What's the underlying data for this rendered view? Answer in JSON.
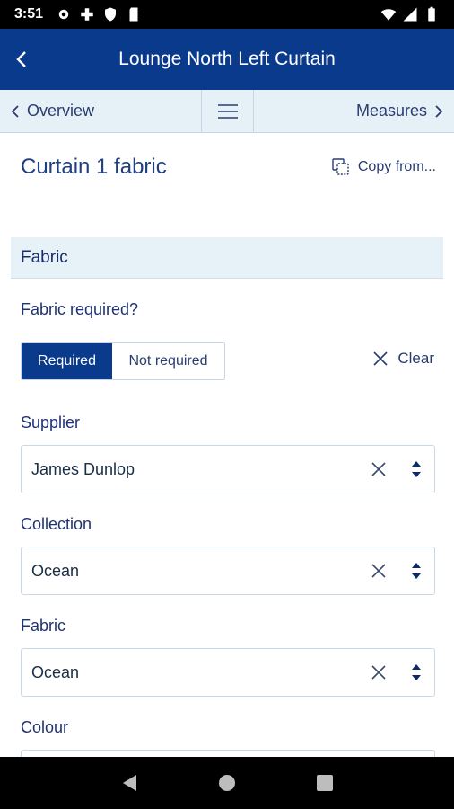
{
  "status_bar": {
    "time": "3:51"
  },
  "app_bar": {
    "title": "Lounge North Left Curtain"
  },
  "sub_nav": {
    "overview_label": "Overview",
    "measures_label": "Measures"
  },
  "page": {
    "heading": "Curtain 1 fabric",
    "copy_from_label": "Copy from..."
  },
  "section": {
    "title": "Fabric"
  },
  "fabric_required": {
    "label": "Fabric required?",
    "options": [
      "Required",
      "Not required"
    ],
    "selected": "Required",
    "clear_label": "Clear"
  },
  "fields": [
    {
      "label": "Supplier",
      "value": "James Dunlop"
    },
    {
      "label": "Collection",
      "value": "Ocean"
    },
    {
      "label": "Fabric",
      "value": "Ocean"
    },
    {
      "label": "Colour",
      "value": ""
    }
  ],
  "colors": {
    "primary": "#0a3a8c",
    "sub_nav_bg": "#e6f0f7",
    "section_bg": "#e6f2f8"
  }
}
